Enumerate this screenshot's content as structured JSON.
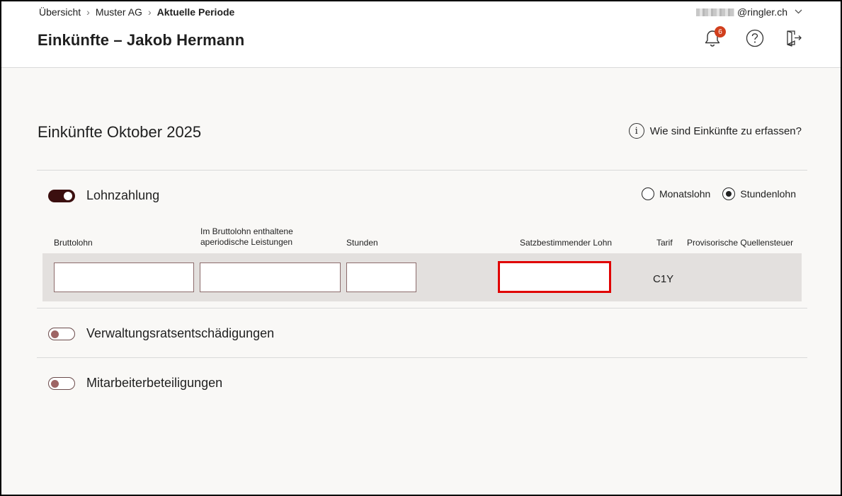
{
  "breadcrumb": {
    "items": [
      "Übersicht",
      "Muster AG"
    ],
    "current": "Aktuelle Periode"
  },
  "header": {
    "title": "Einkünfte – Jakob Hermann",
    "user_email_suffix": "@ringler.ch",
    "notification_count": "6"
  },
  "icons": {
    "bell": "bell-icon",
    "help": "help-icon",
    "logout": "logout-icon",
    "info": "info-icon",
    "chevron": "chevron-down-icon"
  },
  "main": {
    "section_title": "Einkünfte Oktober 2025",
    "help_link": "Wie sind Einkünfte zu erfassen?",
    "lohnzahlung": {
      "label": "Lohnzahlung",
      "enabled": true,
      "pay_type_options": [
        "Monatslohn",
        "Stundenlohn"
      ],
      "pay_type_selected": "Stundenlohn",
      "columns": {
        "bruttolohn": "Bruttolohn",
        "aperiodisch_line1": "Im Bruttolohn enthaltene",
        "aperiodisch_line2": "aperiodische Leistungen",
        "stunden": "Stunden",
        "satzbestimmend": "Satzbestimmender Lohn",
        "tarif": "Tarif",
        "quellensteuer": "Provisorische Quellensteuer"
      },
      "values": {
        "bruttolohn": "",
        "aperiodisch": "",
        "stunden": "",
        "satzbestimmend": "",
        "tarif": "C1Y",
        "quellensteuer": ""
      }
    },
    "verwaltungsrat": {
      "label": "Verwaltungsratsentschädigungen",
      "enabled": false
    },
    "mitarbeiterbeteiligungen": {
      "label": "Mitarbeiterbeteiligungen",
      "enabled": false
    }
  },
  "colors": {
    "toggle_on": "#3b0f0f",
    "toggle_off_knob": "#9e6363",
    "badge": "#d13f1d",
    "focus_border": "#e00000",
    "band": "#e3e0de"
  }
}
